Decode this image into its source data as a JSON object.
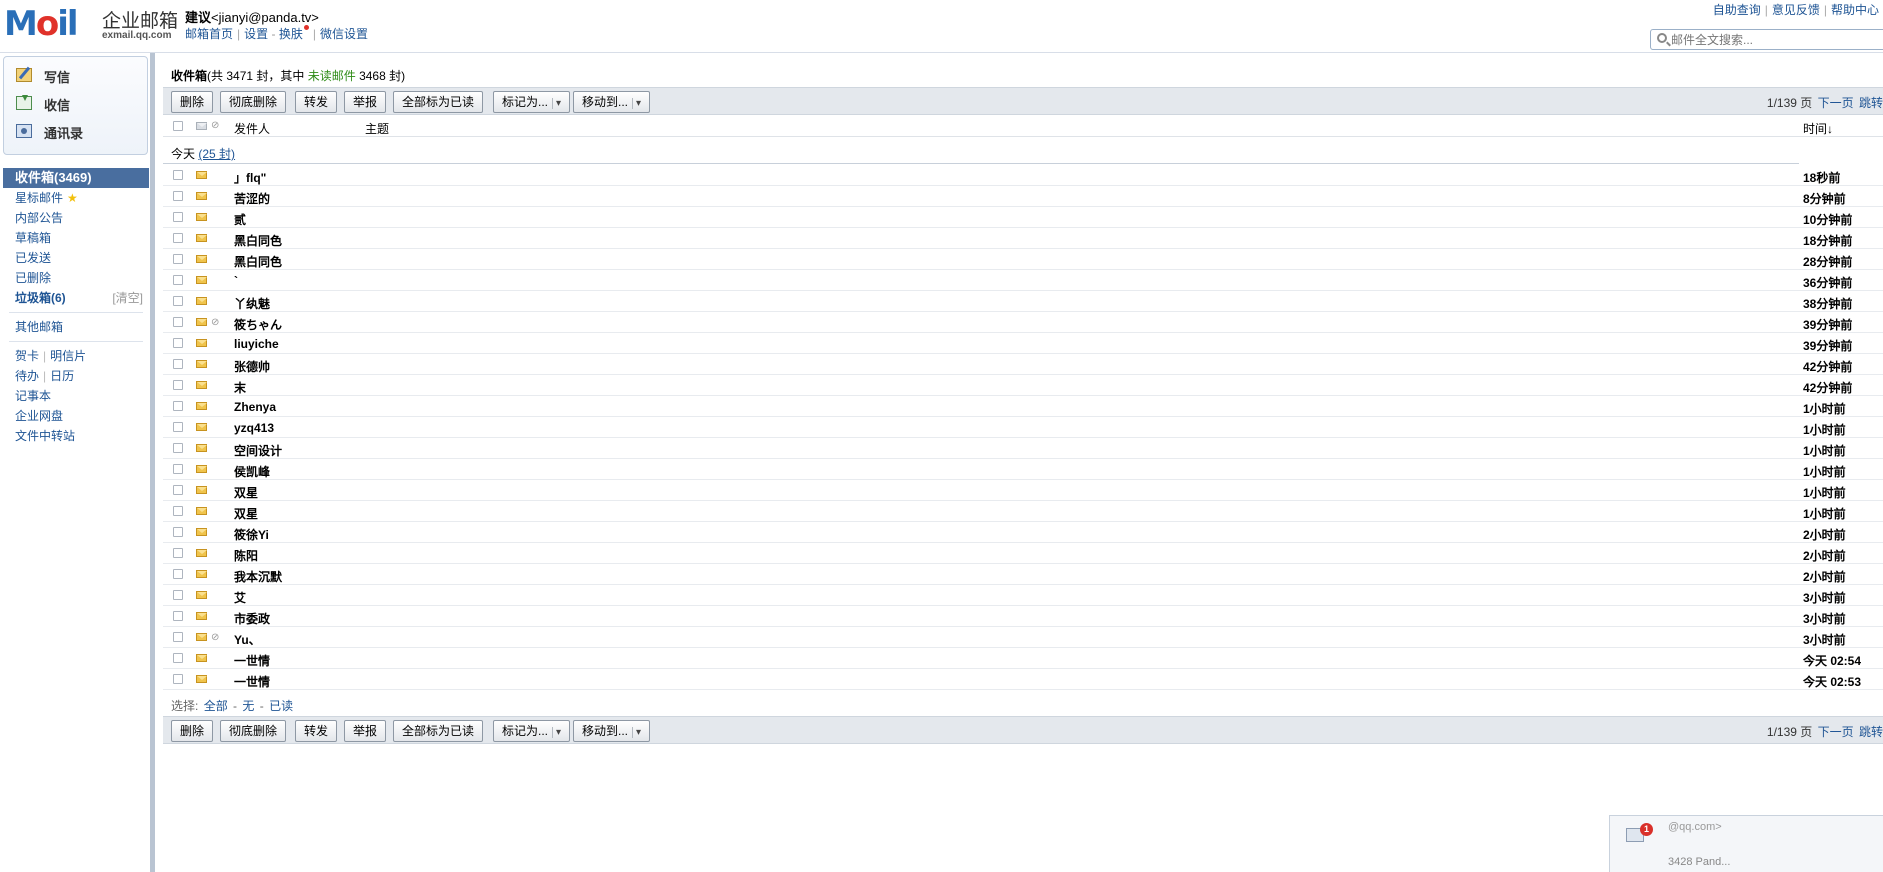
{
  "header": {
    "logo_text_left": "M",
    "logo_text_o": "o",
    "logo_text_right": "il",
    "logo_cn": "企业邮箱",
    "logo_domain": "exmail.qq.com",
    "user_name": "建议",
    "user_email": "<jianyi@panda.tv>",
    "links": [
      "邮箱首页",
      "设置",
      "换肤",
      "微信设置"
    ],
    "right_links": [
      "自助查询",
      "意见反馈",
      "帮助中心"
    ],
    "search_placeholder": "邮件全文搜索..."
  },
  "quick_actions": [
    "写信",
    "收信",
    "通讯录"
  ],
  "folders": {
    "inbox": "收件箱(3469)",
    "starred": "星标邮件",
    "notice": "内部公告",
    "drafts": "草稿箱",
    "sent": "已发送",
    "deleted": "已删除",
    "junk": "垃圾箱(6)",
    "junk_clear": "[清空]",
    "other": "其他邮箱",
    "greeting": "贺卡",
    "postcard": "明信片",
    "todo": "待办",
    "calendar": "日历",
    "notes": "记事本",
    "disk": "企业网盘",
    "transfer": "文件中转站"
  },
  "main": {
    "title": "收件箱",
    "summary_pre": "(共 3471 封，其中 ",
    "summary_unread": "未读邮件",
    "summary_post": " 3468 封)",
    "toolbar": [
      "删除",
      "彻底删除",
      "转发",
      "举报",
      "全部标为已读"
    ],
    "mark_as": "标记为...",
    "move_to": "移动到...",
    "pager_text": "1/139 页",
    "pager_next": "下一页",
    "pager_jump": "跳转",
    "col_sender": "发件人",
    "col_subject": "主题",
    "col_time": "时间↓",
    "group_label": "今天",
    "group_count": "(25 封)",
    "select_label": "选择:",
    "select_all": "全部",
    "select_none": "无",
    "select_read": "已读"
  },
  "emails": [
    {
      "sender": "」flq\"",
      "head": "",
      "preview": "",
      "time": "18秒前",
      "env": "y",
      "clip": false
    },
    {
      "sender": "苦涩的",
      "head": "",
      "preview": "",
      "time": "8分钟前",
      "env": "y",
      "clip": false
    },
    {
      "sender": "贰",
      "head": "",
      "preview": "",
      "time": "10分钟前",
      "env": "y",
      "clip": false
    },
    {
      "sender": "黑白同色",
      "head": "",
      "preview": "",
      "time": "18分钟前",
      "env": "y",
      "clip": false
    },
    {
      "sender": "黑白同色",
      "head": "",
      "preview": "",
      "time": "28分钟前",
      "env": "y",
      "clip": false
    },
    {
      "sender": "`",
      "head": "",
      "preview": "",
      "time": "36分钟前",
      "env": "y",
      "clip": false
    },
    {
      "sender": "丫纨魅",
      "head": "",
      "preview": "",
      "time": "38分钟前",
      "env": "y",
      "clip": false
    },
    {
      "sender": "筱ちゃん",
      "head": "",
      "preview": "",
      "time": "39分钟前",
      "env": "y",
      "clip": true
    },
    {
      "sender": "liuyiche",
      "head": "",
      "preview": "",
      "time": "39分钟前",
      "env": "y",
      "clip": false
    },
    {
      "sender": "张德帅",
      "head": "",
      "preview": "",
      "time": "42分钟前",
      "env": "y",
      "clip": false
    },
    {
      "sender": "末",
      "head": "",
      "preview": "",
      "time": "42分钟前",
      "env": "y",
      "clip": false
    },
    {
      "sender": "Zhenya",
      "head": "",
      "preview": "",
      "time": "1小时前",
      "env": "y",
      "clip": false
    },
    {
      "sender": "yzq413",
      "head": "",
      "preview": "",
      "time": "1小时前",
      "env": "y",
      "clip": false
    },
    {
      "sender": "空间设计",
      "head": "",
      "preview": "",
      "time": "1小时前",
      "env": "y",
      "clip": false
    },
    {
      "sender": "侯凯峰",
      "head": "",
      "preview": "",
      "time": "1小时前",
      "env": "y",
      "clip": false
    },
    {
      "sender": "双星",
      "head": "",
      "preview": "",
      "time": "1小时前",
      "env": "y",
      "clip": false
    },
    {
      "sender": "双星",
      "head": "",
      "preview": "",
      "time": "1小时前",
      "env": "y",
      "clip": false
    },
    {
      "sender": "筱徐Yi",
      "head": "",
      "preview": "",
      "time": "2小时前",
      "env": "y",
      "clip": false
    },
    {
      "sender": "陈阳",
      "head": "",
      "preview": "",
      "time": "2小时前",
      "env": "y",
      "clip": false
    },
    {
      "sender": "我本沉默",
      "head": "",
      "preview": "",
      "time": "2小时前",
      "env": "y",
      "clip": false
    },
    {
      "sender": "艾",
      "head": "",
      "preview": "",
      "time": "3小时前",
      "env": "y",
      "clip": false
    },
    {
      "sender": "市委政",
      "head": "",
      "preview": "",
      "time": "3小时前",
      "env": "y",
      "clip": false
    },
    {
      "sender": "Yu、",
      "head": "",
      "preview": "",
      "time": "3小时前",
      "env": "y",
      "clip": true
    },
    {
      "sender": "一世情",
      "head": "",
      "preview": "",
      "time": "今天 02:54",
      "env": "y",
      "clip": false
    },
    {
      "sender": "一世情",
      "head": "",
      "preview": "",
      "time": "今天 02:53",
      "env": "y",
      "clip": false
    }
  ],
  "notification": {
    "badge": "1",
    "from": "@qq.com>",
    "subject": "",
    "footer": "3428 Pand..."
  }
}
